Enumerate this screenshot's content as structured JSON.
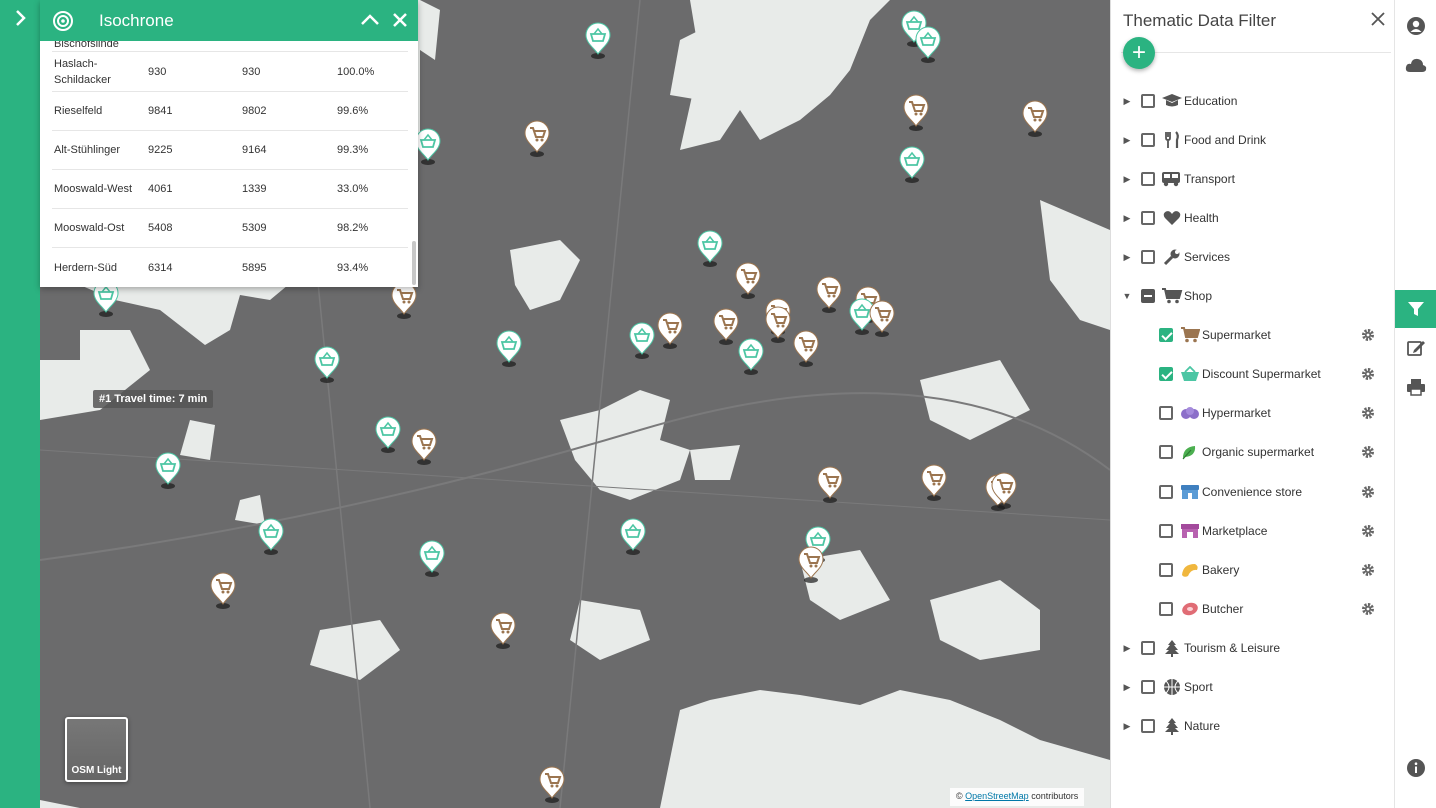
{
  "isochrone": {
    "title": "Isochrone",
    "partial_row": "Bischofslinde",
    "rows": [
      {
        "district": "Haslach-Schildacker",
        "a": "930",
        "b": "930",
        "pct": "100.0%"
      },
      {
        "district": "Rieselfeld",
        "a": "9841",
        "b": "9802",
        "pct": "99.6%"
      },
      {
        "district": "Alt-Stühlinger",
        "a": "9225",
        "b": "9164",
        "pct": "99.3%"
      },
      {
        "district": "Mooswald-West",
        "a": "4061",
        "b": "1339",
        "pct": "33.0%"
      },
      {
        "district": "Mooswald-Ost",
        "a": "5408",
        "b": "5309",
        "pct": "98.2%"
      },
      {
        "district": "Herdern-Süd",
        "a": "6314",
        "b": "5895",
        "pct": "93.4%"
      }
    ]
  },
  "map": {
    "travel_label": "#1 Travel time: 7 min",
    "basemap_label": "OSM Light",
    "attribution_prefix": "©",
    "attribution_link": "OpenStreetMap",
    "attribution_suffix": "contributors",
    "colors": {
      "isochrone": "#6b6b6c",
      "background": "#e8ebe9",
      "supermarket": "#9b7550",
      "discount": "#4cc6a4"
    }
  },
  "filter": {
    "title": "Thematic Data Filter",
    "categories": [
      {
        "label": "Education",
        "icon": "graduation-cap-icon"
      },
      {
        "label": "Food and Drink",
        "icon": "utensils-icon"
      },
      {
        "label": "Transport",
        "icon": "bus-icon"
      },
      {
        "label": "Health",
        "icon": "heart-icon"
      },
      {
        "label": "Services",
        "icon": "wrench-icon"
      },
      {
        "label": "Shop",
        "icon": "cart-icon"
      }
    ],
    "shop_items": [
      {
        "label": "Supermarket",
        "checked": true
      },
      {
        "label": "Discount Supermarket",
        "checked": true
      },
      {
        "label": "Hypermarket",
        "checked": false
      },
      {
        "label": "Organic supermarket",
        "checked": false
      },
      {
        "label": "Convenience store",
        "checked": false
      },
      {
        "label": "Marketplace",
        "checked": false
      },
      {
        "label": "Bakery",
        "checked": false
      },
      {
        "label": "Butcher",
        "checked": false
      }
    ],
    "bottom_categories": [
      {
        "label": "Tourism & Leisure",
        "icon": "tree-icon"
      },
      {
        "label": "Sport",
        "icon": "ball-icon"
      },
      {
        "label": "Nature",
        "icon": "tree-icon"
      }
    ]
  }
}
